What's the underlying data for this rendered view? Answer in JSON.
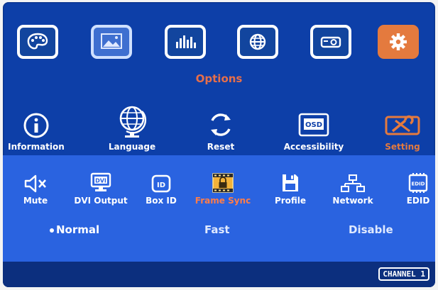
{
  "top_icons": [
    {
      "name": "color-palette-icon",
      "state": "normal"
    },
    {
      "name": "picture-icon",
      "state": "dim"
    },
    {
      "name": "equalizer-icon",
      "state": "normal"
    },
    {
      "name": "globe-window-icon",
      "state": "normal"
    },
    {
      "name": "projector-icon",
      "state": "normal"
    },
    {
      "name": "gear-icon",
      "state": "selected"
    }
  ],
  "section_title": "Options",
  "options_menu": [
    {
      "label": "Information",
      "icon": "info-icon"
    },
    {
      "label": "Language",
      "icon": "globe-icon"
    },
    {
      "label": "Reset",
      "icon": "reset-icon"
    },
    {
      "label": "Accessibility",
      "icon": "osd-icon",
      "icon_text": "OSD"
    },
    {
      "label": "Setting",
      "icon": "tools-icon",
      "selected": true
    }
  ],
  "setting_menu": [
    {
      "label": "Mute",
      "icon": "mute-icon"
    },
    {
      "label": "DVI Output",
      "icon": "dvi-output-icon",
      "icon_text": "DVI"
    },
    {
      "label": "Box ID",
      "icon": "box-id-icon",
      "icon_text": "ID"
    },
    {
      "label": "Frame Sync",
      "icon": "frame-sync-icon",
      "selected": true
    },
    {
      "label": "Profile",
      "icon": "profile-icon"
    },
    {
      "label": "Network",
      "icon": "network-icon"
    },
    {
      "label": "EDID",
      "icon": "edid-icon",
      "icon_text": "EDID"
    }
  ],
  "frame_sync_options": [
    {
      "label": "Normal",
      "active": true
    },
    {
      "label": "Fast"
    },
    {
      "label": "Disable"
    }
  ],
  "footer": {
    "channel": "CHANNEL 1"
  },
  "colors": {
    "accent": "#e47a3e",
    "background": "#0d3fa8",
    "submenu_bg": "#2a63e0",
    "footer_bg": "#0c2f7e"
  }
}
